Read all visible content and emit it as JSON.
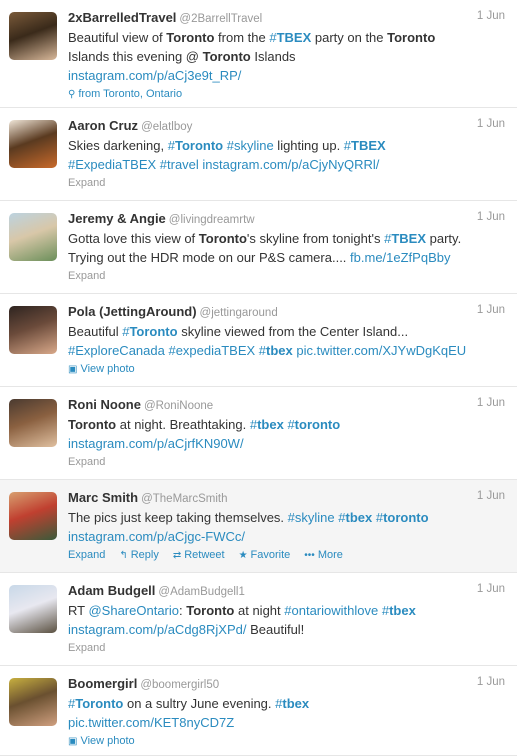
{
  "tweets": [
    {
      "name": "2xBarrelledTravel",
      "handle": "@2BarrellTravel",
      "date": "1 Jun",
      "lines": [
        [
          [
            "t",
            "Beautiful view of "
          ],
          [
            "b",
            "Toronto"
          ],
          [
            "t",
            " from the "
          ],
          [
            "h",
            "#"
          ],
          [
            "hb",
            "TBEX"
          ],
          [
            "t",
            " party on the "
          ],
          [
            "b",
            "Toronto"
          ]
        ],
        [
          [
            "t",
            "Islands this evening @ "
          ],
          [
            "b",
            "Toronto"
          ],
          [
            "t",
            " Islands"
          ]
        ],
        [
          [
            "l",
            "instagram.com/p/aCj3e9t_RP/"
          ]
        ]
      ],
      "meta_text": "from Toronto, Ontario",
      "meta_icon": "location-pin-icon",
      "avatar_colors": [
        "#7a5a3a",
        "#d8b89a",
        "#3a2a1a"
      ]
    },
    {
      "name": "Aaron Cruz",
      "handle": "@elatlboy",
      "date": "1 Jun",
      "lines": [
        [
          [
            "t",
            "Skies darkening, "
          ],
          [
            "h",
            "#"
          ],
          [
            "hb",
            "Toronto"
          ],
          [
            "h",
            " #skyline"
          ],
          [
            "t",
            " lighting up. "
          ],
          [
            "h",
            "#"
          ],
          [
            "hb",
            "TBEX"
          ]
        ],
        [
          [
            "h",
            "#ExpediaTBEX #travel "
          ],
          [
            "l",
            "instagram.com/p/aCjyNyQRRl/"
          ]
        ]
      ],
      "meta_text": "Expand",
      "avatar_colors": [
        "#f0e6d8",
        "#c96a2b",
        "#5a3a20"
      ]
    },
    {
      "name": "Jeremy & Angie",
      "handle": "@livingdreamrtw",
      "date": "1 Jun",
      "lines": [
        [
          [
            "t",
            "Gotta love this view of "
          ],
          [
            "b",
            "Toronto"
          ],
          [
            "t",
            "'s skyline from tonight's "
          ],
          [
            "h",
            "#"
          ],
          [
            "hb",
            "TBEX"
          ],
          [
            "t",
            " party."
          ]
        ],
        [
          [
            "t",
            "Trying out the HDR mode on our P&S camera.... "
          ],
          [
            "l",
            "fb.me/1eZfPqBby"
          ]
        ]
      ],
      "meta_text": "Expand",
      "avatar_colors": [
        "#bcd3e0",
        "#6b8f5a",
        "#d8c7a8"
      ]
    },
    {
      "name": "Pola (JettingAround)",
      "handle": "@jettingaround",
      "date": "1 Jun",
      "lines": [
        [
          [
            "t",
            "Beautiful "
          ],
          [
            "h",
            "#"
          ],
          [
            "hb",
            "Toronto"
          ],
          [
            "t",
            " skyline viewed from the Center Island..."
          ]
        ],
        [
          [
            "h",
            "#ExploreCanada #expediaTBEX #"
          ],
          [
            "hb",
            "tbex"
          ],
          [
            "t",
            " "
          ],
          [
            "l",
            "pic.twitter.com/XJYwDgKqEU"
          ]
        ]
      ],
      "meta_text": "View photo",
      "meta_icon": "photo-icon",
      "avatar_colors": [
        "#2e2420",
        "#d9a98a",
        "#6a4a3a"
      ]
    },
    {
      "name": "Roni Noone",
      "handle": "@RoniNoone",
      "date": "1 Jun",
      "lines": [
        [
          [
            "b",
            "Toronto"
          ],
          [
            "t",
            " at night. Breathtaking.  "
          ],
          [
            "h",
            "#"
          ],
          [
            "hb",
            "tbex"
          ],
          [
            "t",
            " "
          ],
          [
            "h",
            "#"
          ],
          [
            "hb",
            "toronto"
          ]
        ],
        [
          [
            "l",
            "instagram.com/p/aCjrfKN90W/"
          ]
        ]
      ],
      "meta_text": "Expand",
      "avatar_colors": [
        "#4a3a30",
        "#e0c0a0",
        "#8a6040"
      ]
    },
    {
      "name": "Marc Smith",
      "handle": "@TheMarcSmith",
      "date": "1 Jun",
      "lines": [
        [
          [
            "t",
            "The pics just keep taking themselves. "
          ],
          [
            "h",
            "#skyline #"
          ],
          [
            "hb",
            "tbex"
          ],
          [
            "t",
            " "
          ],
          [
            "h",
            "#"
          ],
          [
            "hb",
            "toronto"
          ]
        ],
        [
          [
            "l",
            "instagram.com/p/aCjgc-FWCc/"
          ]
        ]
      ],
      "meta_text": "Expand",
      "actions": [
        {
          "icon": "reply-icon",
          "glyph": "↰",
          "label": "Reply"
        },
        {
          "icon": "retweet-icon",
          "glyph": "⇄",
          "label": "Retweet"
        },
        {
          "icon": "favorite-icon",
          "glyph": "★",
          "label": "Favorite"
        },
        {
          "icon": "more-icon",
          "glyph": "•••",
          "label": "More"
        }
      ],
      "hover": true,
      "avatar_colors": [
        "#d8a070",
        "#3a5a3a",
        "#c04030"
      ]
    },
    {
      "name": "Adam Budgell",
      "handle": "@AdamBudgell1",
      "date": "1 Jun",
      "lines": [
        [
          [
            "t",
            "RT "
          ],
          [
            "l",
            "@ShareOntario"
          ],
          [
            "t",
            ": "
          ],
          [
            "b",
            "Toronto"
          ],
          [
            "t",
            " at night "
          ],
          [
            "h",
            "#ontariowithlove #"
          ],
          [
            "hb",
            "tbex"
          ]
        ],
        [
          [
            "l",
            "instagram.com/p/aCdg8RjXPd/"
          ],
          [
            "t",
            " Beautiful!"
          ]
        ]
      ],
      "meta_text": "Expand",
      "avatar_colors": [
        "#c8d8e8",
        "#5a5040",
        "#e8e8f0"
      ]
    },
    {
      "name": "Boomergirl",
      "handle": "@boomergirl50",
      "date": "1 Jun",
      "lines": [
        [
          [
            "h",
            "#"
          ],
          [
            "hb",
            "Toronto"
          ],
          [
            "t",
            " on a sultry June evening. "
          ],
          [
            "h",
            "#"
          ],
          [
            "hb",
            "tbex"
          ]
        ],
        [
          [
            "l",
            "pic.twitter.com/KET8nyCD7Z"
          ]
        ]
      ],
      "meta_text": "View photo",
      "meta_icon": "photo-icon",
      "avatar_colors": [
        "#c8b040",
        "#d0a080",
        "#6a5030"
      ]
    }
  ],
  "colors": {
    "link": "#2a8bbf",
    "muted": "#999999",
    "text": "#333333"
  }
}
